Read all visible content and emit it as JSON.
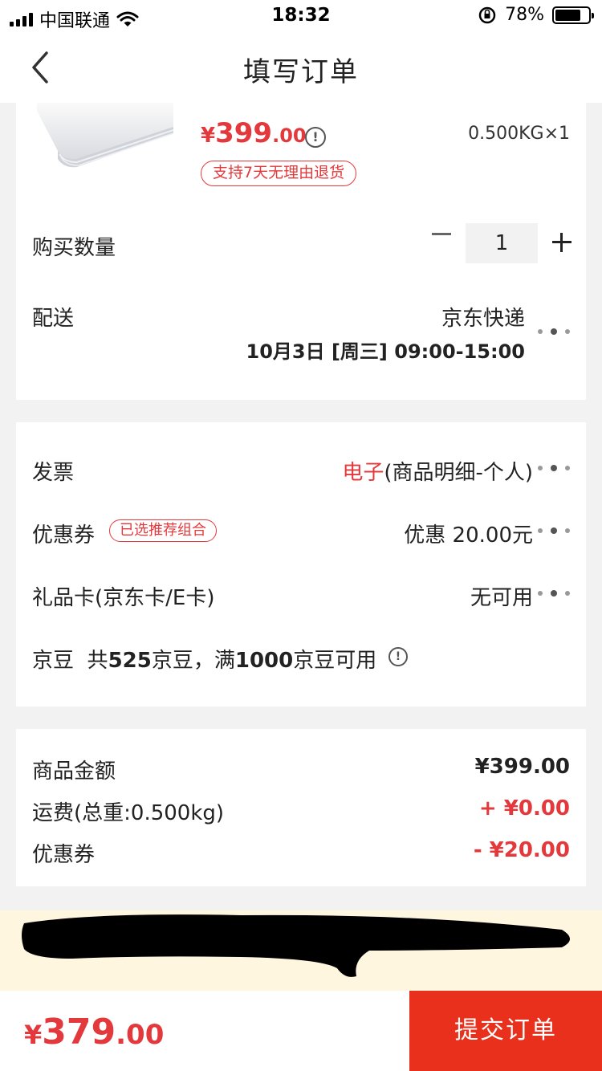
{
  "status_bar": {
    "carrier": "中国联通",
    "time": "18:32",
    "battery": "78%"
  },
  "header": {
    "title": "填写订单"
  },
  "product": {
    "price_yen": "¥",
    "price_int": "399",
    "price_dec": ".00",
    "weight": "0.500KG×1",
    "return_tag": "支持7天无理由退货"
  },
  "quantity": {
    "label": "购买数量",
    "value": "1"
  },
  "delivery": {
    "label": "配送",
    "carrier": "京东快递",
    "time": "10月3日 [周三] 09:00-15:00"
  },
  "invoice": {
    "label": "发票",
    "type": "电子",
    "detail": "(商品明细-个人)"
  },
  "coupon": {
    "label": "优惠券",
    "tag": "已选推荐组合",
    "value": "优惠 20.00元"
  },
  "giftcard": {
    "label": "礼品卡(京东卡/E卡)",
    "value": "无可用"
  },
  "jingdou": {
    "label": "京豆",
    "t1": "共",
    "count": "525",
    "t2": "京豆，满",
    "min": "1000",
    "t3": "京豆可用"
  },
  "summary": {
    "goods_label": "商品金额",
    "goods_value": "¥399.00",
    "shipping_label": "运费(总重:0.500kg)",
    "shipping_value": "+ ¥0.00",
    "coupon_label": "优惠券",
    "coupon_value": "- ¥20.00"
  },
  "footer": {
    "total_yen": "¥",
    "total_int": "379",
    "total_dec": ".00",
    "submit": "提交订单"
  },
  "colors": {
    "accent": "#e4393c",
    "submit_bg": "#e9301c",
    "notice_bg": "#fff6e0"
  }
}
